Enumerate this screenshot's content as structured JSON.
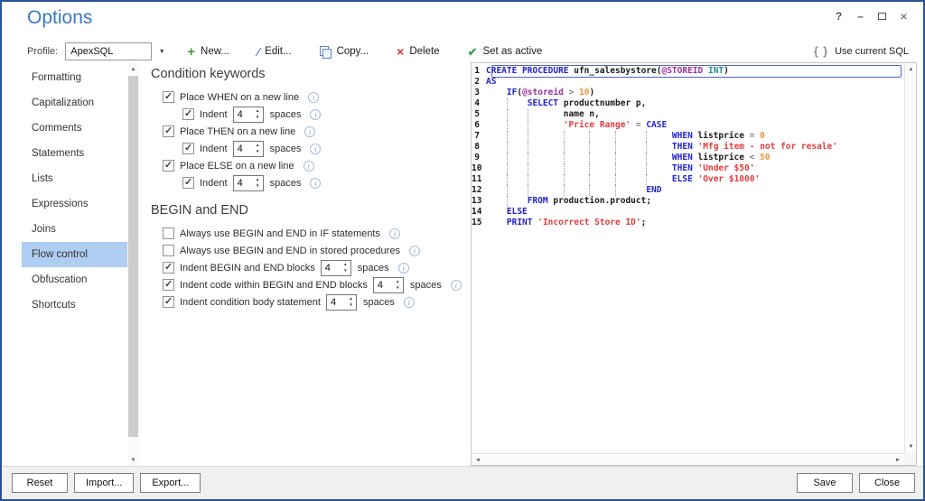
{
  "window": {
    "title": "Options",
    "controls": {
      "help": "?",
      "minimize": "–",
      "close": "×"
    }
  },
  "toolbar": {
    "profile_label": "Profile:",
    "profile_value": "ApexSQL",
    "new_label": "New...",
    "edit_label": "Edit...",
    "copy_label": "Copy...",
    "delete_label": "Delete",
    "set_active_label": "Set as active",
    "use_current_sql_label": "Use current SQL"
  },
  "icons": {
    "new": "+",
    "edit": "∕",
    "delete": "×",
    "set_active": "✔",
    "use_sql": "{ }",
    "dropdown": "▼",
    "spin_up": "▲",
    "spin_down": "▼",
    "scroll_up": "▲",
    "scroll_down": "▼",
    "scroll_left": "◄",
    "scroll_right": "►",
    "info": "i"
  },
  "sidebar": {
    "items": [
      {
        "label": "Formatting",
        "selected": false
      },
      {
        "label": "Capitalization",
        "selected": false
      },
      {
        "label": "Comments",
        "selected": false
      },
      {
        "label": "Statements",
        "selected": false
      },
      {
        "label": "Lists",
        "selected": false
      },
      {
        "label": "Expressions",
        "selected": false
      },
      {
        "label": "Joins",
        "selected": false
      },
      {
        "label": "Flow control",
        "selected": true
      },
      {
        "label": "Obfuscation",
        "selected": false
      },
      {
        "label": "Shortcuts",
        "selected": false
      }
    ]
  },
  "options_panel": {
    "sections": [
      {
        "heading": "Condition keywords",
        "rows": [
          {
            "sub": false,
            "checked": true,
            "label": "Place WHEN on a new line",
            "spinner": null,
            "suffix": null,
            "info": true
          },
          {
            "sub": true,
            "checked": true,
            "label": "Indent",
            "spinner": "4",
            "suffix": "spaces",
            "info": true
          },
          {
            "sub": false,
            "checked": true,
            "label": "Place THEN on a new line",
            "spinner": null,
            "suffix": null,
            "info": true
          },
          {
            "sub": true,
            "checked": true,
            "label": "Indent",
            "spinner": "4",
            "suffix": "spaces",
            "info": true
          },
          {
            "sub": false,
            "checked": true,
            "label": "Place ELSE on a new line",
            "spinner": null,
            "suffix": null,
            "info": true
          },
          {
            "sub": true,
            "checked": true,
            "label": "Indent",
            "spinner": "4",
            "suffix": "spaces",
            "info": true
          }
        ]
      },
      {
        "heading": "BEGIN and END",
        "rows": [
          {
            "sub": false,
            "checked": false,
            "label": "Always use BEGIN and END in IF statements",
            "spinner": null,
            "suffix": null,
            "info": true
          },
          {
            "sub": false,
            "checked": false,
            "label": "Always use BEGIN and END in stored procedures",
            "spinner": null,
            "suffix": null,
            "info": true
          },
          {
            "sub": false,
            "checked": true,
            "label": "Indent BEGIN and END blocks",
            "spinner": "4",
            "suffix": "spaces",
            "info": true
          },
          {
            "sub": false,
            "checked": true,
            "label": "Indent code within BEGIN and END blocks",
            "spinner": "4",
            "suffix": "spaces",
            "info": true
          },
          {
            "sub": false,
            "checked": true,
            "label": "Indent condition body statement",
            "spinner": "4",
            "suffix": "spaces",
            "info": true
          }
        ]
      }
    ]
  },
  "code_panel": {
    "syntax_colors": {
      "keyword": "#2323cc",
      "plain": "#1a1a1a",
      "variable": "#9a2f9a",
      "type": "#1f8e8e",
      "string": "#e23b3b",
      "number": "#e5973d",
      "operator": "#7f7f7f"
    },
    "lines": [
      {
        "num": 1,
        "current": true,
        "guides": [],
        "tokens": [
          [
            "k",
            "CREATE PROCEDURE"
          ],
          [
            "p",
            " ufn_salesbystore("
          ],
          [
            "v",
            "@STOREID"
          ],
          [
            "t",
            " INT"
          ],
          [
            "p",
            ")"
          ]
        ]
      },
      {
        "num": 2,
        "current": false,
        "guides": [],
        "tokens": [
          [
            "k",
            "AS"
          ]
        ]
      },
      {
        "num": 3,
        "current": false,
        "guides": [],
        "tokens": [
          [
            "p",
            "    "
          ],
          [
            "k",
            "IF"
          ],
          [
            "p",
            "("
          ],
          [
            "v",
            "@storeid"
          ],
          [
            "o",
            " > "
          ],
          [
            "n",
            "10"
          ],
          [
            "p",
            ")"
          ]
        ]
      },
      {
        "num": 4,
        "current": false,
        "guides": [
          4
        ],
        "tokens": [
          [
            "p",
            "        "
          ],
          [
            "k",
            "SELECT"
          ],
          [
            "p",
            " productnumber p,"
          ]
        ]
      },
      {
        "num": 5,
        "current": false,
        "guides": [
          4,
          8
        ],
        "tokens": [
          [
            "p",
            "               name n,"
          ]
        ]
      },
      {
        "num": 6,
        "current": false,
        "guides": [
          4,
          8
        ],
        "tokens": [
          [
            "p",
            "               "
          ],
          [
            "s",
            "'Price Range'"
          ],
          [
            "o",
            " = "
          ],
          [
            "k",
            "CASE"
          ]
        ]
      },
      {
        "num": 7,
        "current": false,
        "guides": [
          4,
          8,
          15,
          20,
          25,
          31
        ],
        "tokens": [
          [
            "p",
            "                                    "
          ],
          [
            "k",
            "WHEN"
          ],
          [
            "p",
            " listprice"
          ],
          [
            "o",
            " = "
          ],
          [
            "n",
            "0"
          ]
        ]
      },
      {
        "num": 8,
        "current": false,
        "guides": [
          4,
          8,
          15,
          20,
          25,
          31
        ],
        "tokens": [
          [
            "p",
            "                                    "
          ],
          [
            "k",
            "THEN"
          ],
          [
            "p",
            " "
          ],
          [
            "s",
            "'Mfg item - not for resale'"
          ]
        ]
      },
      {
        "num": 9,
        "current": false,
        "guides": [
          4,
          8,
          15,
          20,
          25,
          31
        ],
        "tokens": [
          [
            "p",
            "                                    "
          ],
          [
            "k",
            "WHEN"
          ],
          [
            "p",
            " listprice"
          ],
          [
            "o",
            " < "
          ],
          [
            "n",
            "50"
          ]
        ]
      },
      {
        "num": 10,
        "current": false,
        "guides": [
          4,
          8,
          15,
          20,
          25,
          31
        ],
        "tokens": [
          [
            "p",
            "                                    "
          ],
          [
            "k",
            "THEN"
          ],
          [
            "p",
            " "
          ],
          [
            "s",
            "'Under $50'"
          ]
        ]
      },
      {
        "num": 11,
        "current": false,
        "guides": [
          4,
          8,
          15,
          20,
          25,
          31
        ],
        "tokens": [
          [
            "p",
            "                                    "
          ],
          [
            "k",
            "ELSE"
          ],
          [
            "p",
            " "
          ],
          [
            "s",
            "'Over $1000'"
          ]
        ]
      },
      {
        "num": 12,
        "current": false,
        "guides": [
          4,
          8,
          15,
          20,
          25
        ],
        "tokens": [
          [
            "p",
            "                               "
          ],
          [
            "k",
            "END"
          ]
        ]
      },
      {
        "num": 13,
        "current": false,
        "guides": [
          4
        ],
        "tokens": [
          [
            "p",
            "        "
          ],
          [
            "k",
            "FROM"
          ],
          [
            "p",
            " production.product;"
          ]
        ]
      },
      {
        "num": 14,
        "current": false,
        "guides": [],
        "tokens": [
          [
            "p",
            "    "
          ],
          [
            "k",
            "ELSE"
          ]
        ]
      },
      {
        "num": 15,
        "current": false,
        "guides": [],
        "tokens": [
          [
            "p",
            "    "
          ],
          [
            "k",
            "PRINT"
          ],
          [
            "p",
            " "
          ],
          [
            "s",
            "'Incorrect Store ID'"
          ],
          [
            "p",
            ";"
          ]
        ]
      }
    ]
  },
  "footer": {
    "reset_label": "Reset",
    "import_label": "Import...",
    "export_label": "Export...",
    "save_label": "Save",
    "close_label": "Close"
  },
  "colors": {
    "title": "#3779c4",
    "window_border": "#2a5296",
    "sidebar_selected": "#aecdf0",
    "set_active_bg": "#cfe2f6",
    "footer_bg": "#f0f0f0"
  }
}
